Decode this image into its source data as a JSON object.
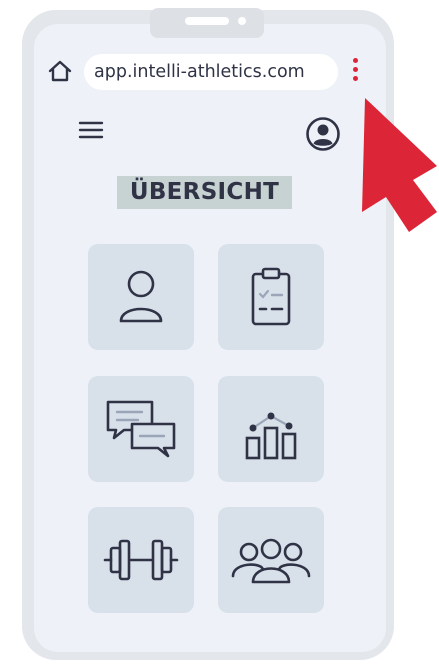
{
  "browser": {
    "url": "app.intelli-athletics.com",
    "home_icon": "home-icon",
    "menu_icon": "kebab-menu-icon",
    "menu_dot_color": "#dd2538"
  },
  "header": {
    "menu_icon": "hamburger-menu-icon",
    "profile_icon": "user-circle-icon"
  },
  "main": {
    "title": "ÜBERSICHT",
    "tiles": [
      {
        "icon": "user-icon"
      },
      {
        "icon": "clipboard-checklist-icon"
      },
      {
        "icon": "chat-bubbles-icon"
      },
      {
        "icon": "bar-chart-trend-icon"
      },
      {
        "icon": "dumbbell-icon"
      },
      {
        "icon": "group-icon"
      }
    ]
  },
  "annotation": {
    "arrow_color": "#dd2538"
  }
}
